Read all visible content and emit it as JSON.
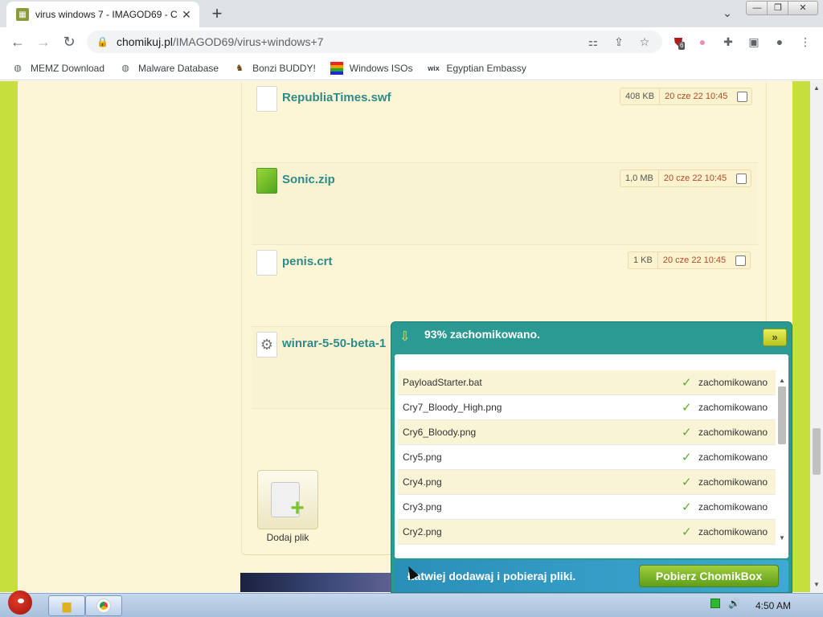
{
  "browser": {
    "tab_title": "virus windows 7 - IMAGOD69 - C",
    "tab_close": "✕",
    "new_tab": "+",
    "tab_search": "⌄",
    "url_host": "chomikuj.pl",
    "url_path": "/IMAGOD69/virus+windows+7",
    "extension_badge": "6",
    "window_controls": {
      "minimize": "—",
      "restore": "❐",
      "close": "✕"
    }
  },
  "bookmarks": [
    {
      "label": "MEMZ Download",
      "icon": "globe-icon"
    },
    {
      "label": "Malware Database",
      "icon": "globe-icon"
    },
    {
      "label": "Bonzi BUDDY!",
      "icon": "bonzi-icon"
    },
    {
      "label": "Windows ISOs",
      "icon": "windows-flag-icon"
    },
    {
      "label": "Egyptian Embassy",
      "icon": "wix-icon"
    }
  ],
  "files": [
    {
      "name": "RepubliaTimes.swf",
      "size": "408 KB",
      "date": "20 cze 22 10:45",
      "icon": "document-icon"
    },
    {
      "name": "Sonic.zip",
      "size": "1,0 MB",
      "date": "20 cze 22 10:45",
      "icon": "zip-icon"
    },
    {
      "name": "penis.crt",
      "size": "1 KB",
      "date": "20 cze 22 10:45",
      "icon": "document-icon"
    },
    {
      "name": "winrar-5-50-beta-1",
      "size": "",
      "date": "",
      "icon": "settings-file-icon"
    }
  ],
  "add_file": {
    "label": "Dodaj plik"
  },
  "popup": {
    "title": "93% zachomikowano.",
    "collapse": "»",
    "items": [
      {
        "name": "PayloadStarter.bat",
        "status": "zachomikowano"
      },
      {
        "name": "Cry7_Bloody_High.png",
        "status": "zachomikowano"
      },
      {
        "name": "Cry6_Bloody.png",
        "status": "zachomikowano"
      },
      {
        "name": "Cry5.png",
        "status": "zachomikowano"
      },
      {
        "name": "Cry4.png",
        "status": "zachomikowano"
      },
      {
        "name": "Cry3.png",
        "status": "zachomikowano"
      },
      {
        "name": "Cry2.png",
        "status": "zachomikowano"
      }
    ],
    "promo": "Łatwiej dodawaj i pobieraj pliki.",
    "cta": "Pobierz ChomikBox"
  },
  "taskbar": {
    "clock": "4:50 AM"
  },
  "colors": {
    "page_bg": "#c7df3c",
    "content_bg": "#fdf6d6",
    "link": "#2f8a8a",
    "popup": "#2a9a92",
    "date": "#b5472a"
  }
}
